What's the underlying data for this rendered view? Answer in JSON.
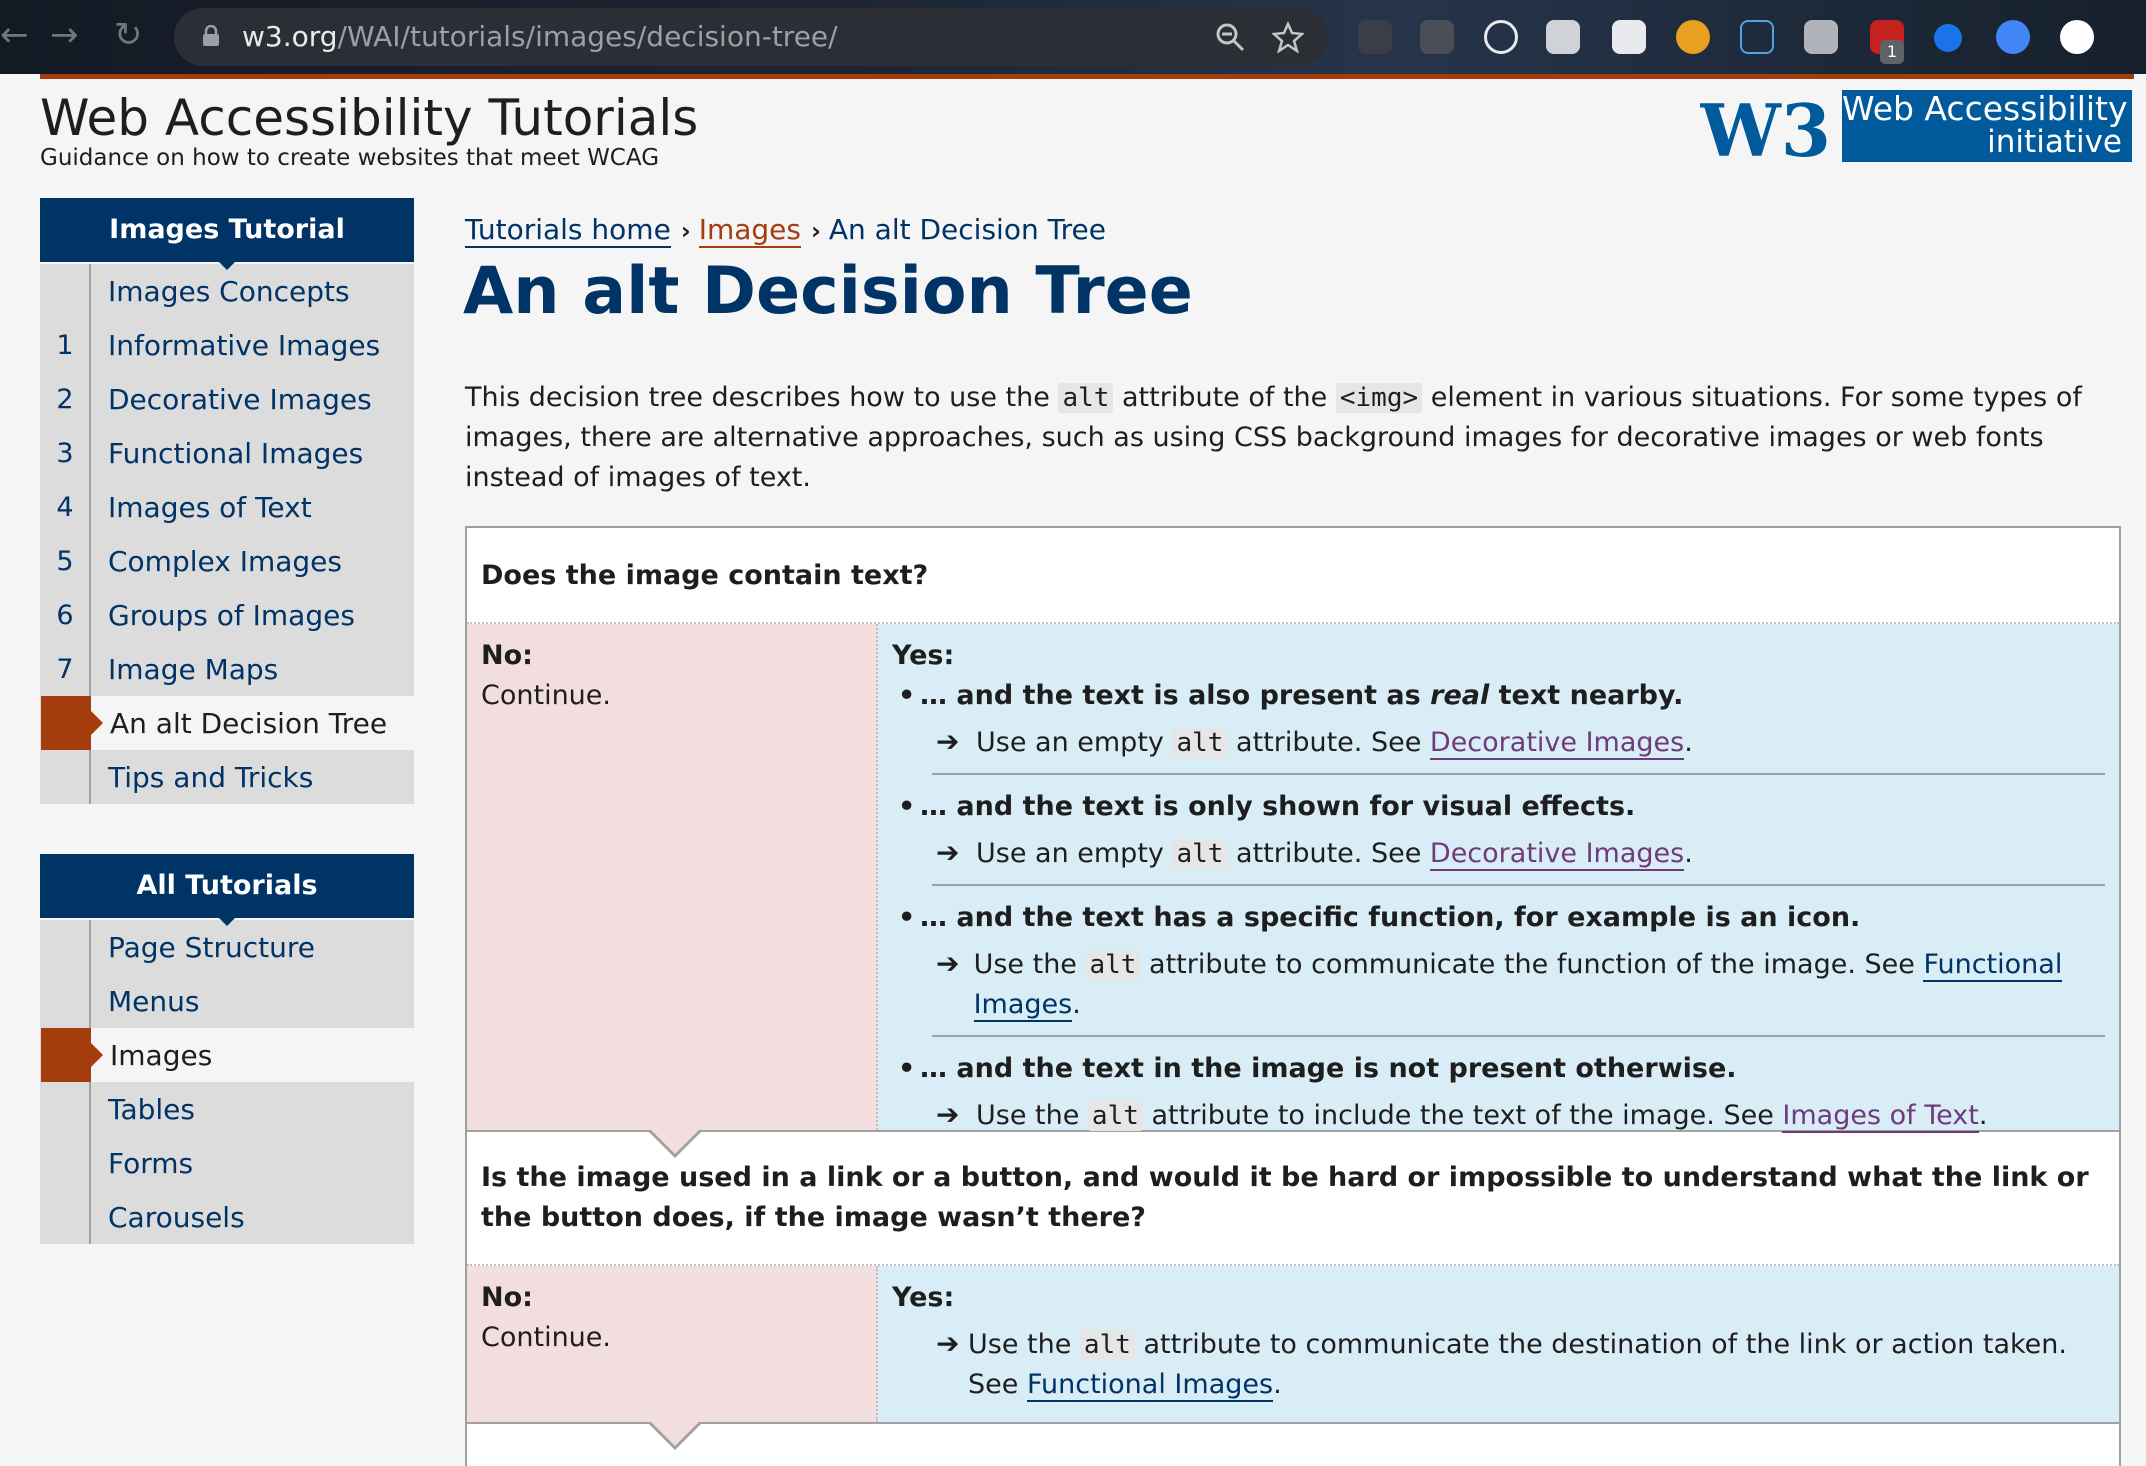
{
  "browser": {
    "url_host": "w3.org",
    "url_path": "/WAI/tutorials/images/decision-tree/",
    "extension_badge": "1"
  },
  "header": {
    "site_title": "Web Accessibility Tutorials",
    "site_subtitle": "Guidance on how to create websites that meet WCAG",
    "wai_line1": "Web Accessibility",
    "wai_line2": "initiative",
    "w3c_logo_text": "W3C",
    "brand_color": "#005a9c",
    "accent_color": "#a53c0d"
  },
  "images_tutorial": {
    "title": "Images Tutorial",
    "items": [
      {
        "num": "",
        "label": "Images Concepts"
      },
      {
        "num": "1",
        "label": "Informative Images"
      },
      {
        "num": "2",
        "label": "Decorative Images"
      },
      {
        "num": "3",
        "label": "Functional Images"
      },
      {
        "num": "4",
        "label": "Images of Text"
      },
      {
        "num": "5",
        "label": "Complex Images"
      },
      {
        "num": "6",
        "label": "Groups of Images"
      },
      {
        "num": "7",
        "label": "Image Maps"
      },
      {
        "num": "",
        "label": "An alt Decision Tree"
      },
      {
        "num": "",
        "label": "Tips and Tricks"
      }
    ]
  },
  "all_tutorials": {
    "title": "All Tutorials",
    "items": [
      {
        "label": "Page Structure"
      },
      {
        "label": "Menus"
      },
      {
        "label": "Images"
      },
      {
        "label": "Tables"
      },
      {
        "label": "Forms"
      },
      {
        "label": "Carousels"
      }
    ]
  },
  "breadcrumb": {
    "home": "Tutorials home",
    "images": "Images",
    "current": "An alt Decision Tree"
  },
  "page_title": "An alt Decision Tree",
  "intro": {
    "t1": "This decision tree describes how to use the ",
    "code1": "alt",
    "t2": " attribute of the ",
    "code2": "<img>",
    "t3": " element in various situations. For some types of images, there are alternative approaches, such as using CSS background images for decorative images or web fonts instead of images of text."
  },
  "tree": {
    "q1": {
      "question": "Does the image contain text?",
      "no_label": "No:",
      "no_text": "Continue.",
      "yes_label": "Yes:",
      "cases": [
        {
          "pre": "… and the text is also present as ",
          "em": "real",
          "post": " text nearby.",
          "a1": "Use an empty ",
          "code": "alt",
          "a2": " attribute. See ",
          "link": "Decorative Images",
          "a3": "."
        },
        {
          "pre": "… and the text is only shown for visual effects.",
          "em": "",
          "post": "",
          "a1": "Use an empty ",
          "code": "alt",
          "a2": " attribute. See ",
          "link": "Decorative Images",
          "a3": "."
        },
        {
          "pre": "… and the text has a specific function, for example is an icon.",
          "em": "",
          "post": "",
          "a1": "Use the ",
          "code": "alt",
          "a2": " attribute to communicate the function of the image. See ",
          "link": "Functional Images",
          "a3": "."
        },
        {
          "pre": "… and the text in the image is not present otherwise.",
          "em": "",
          "post": "",
          "a1": "Use the ",
          "code": "alt",
          "a2": " attribute to include the text of the image. See ",
          "link": "Images of Text",
          "a3": "."
        }
      ]
    },
    "q2": {
      "question": "Is the image used in a link or a button, and would it be hard or impossible to understand what the link or the button does, if the image wasn’t there?",
      "no_label": "No:",
      "no_text": "Continue.",
      "yes_label": "Yes:",
      "a1": "Use the ",
      "code": "alt",
      "a2": " attribute to communicate the destination of the link or action taken. See ",
      "link": "Functional Images",
      "a3": "."
    }
  }
}
